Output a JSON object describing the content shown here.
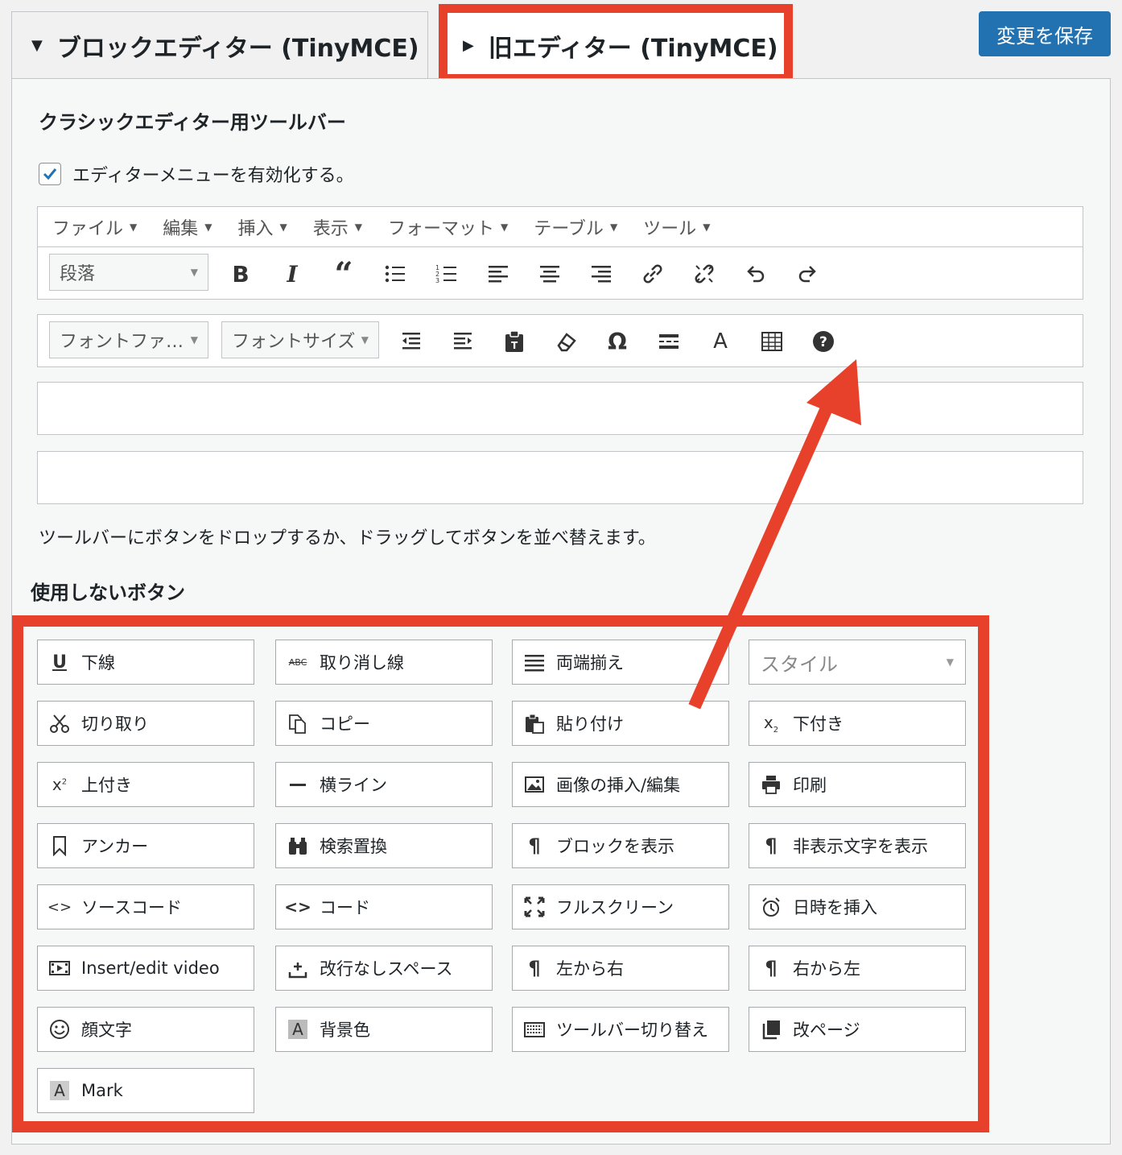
{
  "tabs": {
    "block": "ブロックエディター (TinyMCE)",
    "classic": "旧エディター (TinyMCE)"
  },
  "save_label": "変更を保存",
  "section_title": "クラシックエディター用ツールバー",
  "enable_label": "エディターメニューを有効化する。",
  "menubar": [
    "ファイル",
    "編集",
    "挿入",
    "表示",
    "フォーマット",
    "テーブル",
    "ツール"
  ],
  "toolbar1": {
    "format_select": "段落",
    "icons": [
      "bold-icon",
      "italic-icon",
      "blockquote-icon",
      "bullet-list-icon",
      "numbered-list-icon",
      "align-left-icon",
      "align-center-icon",
      "align-right-icon",
      "link-icon",
      "unlink-icon",
      "undo-icon",
      "redo-icon"
    ]
  },
  "toolbar2": {
    "font_family_select": "フォントファ…",
    "font_size_select": "フォントサイズ",
    "icons": [
      "outdent-icon",
      "indent-icon",
      "paste-text-icon",
      "clear-format-icon",
      "omega-icon",
      "read-more-icon",
      "text-color-icon",
      "table-icon",
      "help-icon"
    ]
  },
  "hint": "ツールバーにボタンをドロップするか、ドラッグしてボタンを並べ替えます。",
  "unused_title": "使用しないボタン",
  "unused_buttons": [
    {
      "label": "下線",
      "icon": "underline-icon"
    },
    {
      "label": "取り消し線",
      "icon": "strikethrough-icon"
    },
    {
      "label": "両端揃え",
      "icon": "justify-icon"
    },
    {
      "label": "スタイル",
      "icon": ""
    },
    {
      "label": "切り取り",
      "icon": "scissors-icon"
    },
    {
      "label": "コピー",
      "icon": "copy-icon"
    },
    {
      "label": "貼り付け",
      "icon": "paste-icon"
    },
    {
      "label": "下付き",
      "icon": "subscript-icon"
    },
    {
      "label": "上付き",
      "icon": "superscript-icon"
    },
    {
      "label": "横ライン",
      "icon": "horizontal-line-icon"
    },
    {
      "label": "画像の挿入/編集",
      "icon": "image-icon"
    },
    {
      "label": "印刷",
      "icon": "print-icon"
    },
    {
      "label": "アンカー",
      "icon": "bookmark-icon"
    },
    {
      "label": "検索置換",
      "icon": "binoculars-icon"
    },
    {
      "label": "ブロックを表示",
      "icon": "pilcrow-icon"
    },
    {
      "label": "非表示文字を表示",
      "icon": "pilcrow-icon"
    },
    {
      "label": "ソースコード",
      "icon": "source-code-icon"
    },
    {
      "label": "コード",
      "icon": "code-icon"
    },
    {
      "label": "フルスクリーン",
      "icon": "fullscreen-icon"
    },
    {
      "label": "日時を挿入",
      "icon": "alarm-clock-icon"
    },
    {
      "label": "Insert/edit video",
      "icon": "video-icon"
    },
    {
      "label": "改行なしスペース",
      "icon": "nonbreaking-icon"
    },
    {
      "label": "左から右",
      "icon": "ltr-icon"
    },
    {
      "label": "右から左",
      "icon": "rtl-icon"
    },
    {
      "label": "顔文字",
      "icon": "smiley-icon"
    },
    {
      "label": "背景色",
      "icon": "background-color-icon"
    },
    {
      "label": "ツールバー切り替え",
      "icon": "keyboard-icon"
    },
    {
      "label": "改ページ",
      "icon": "page-break-icon"
    },
    {
      "label": "Mark",
      "icon": "mark-icon"
    }
  ],
  "colors": {
    "accent": "#2271b1",
    "highlight": "#e8412b"
  }
}
